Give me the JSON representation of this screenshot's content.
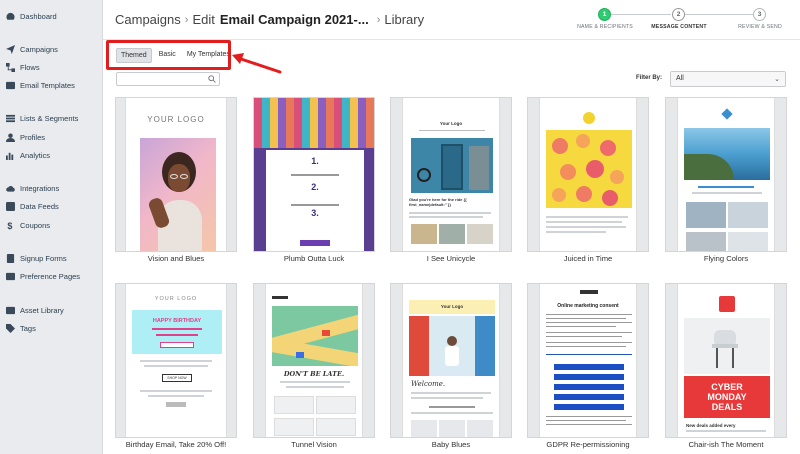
{
  "sidebar": {
    "items": [
      {
        "label": "Dashboard",
        "icon": "dashboard-icon"
      },
      {
        "label": "Campaigns",
        "icon": "send-icon"
      },
      {
        "label": "Flows",
        "icon": "flow-icon"
      },
      {
        "label": "Email Templates",
        "icon": "template-icon"
      },
      {
        "label": "Lists & Segments",
        "icon": "list-icon"
      },
      {
        "label": "Profiles",
        "icon": "user-icon"
      },
      {
        "label": "Analytics",
        "icon": "chart-icon"
      },
      {
        "label": "Integrations",
        "icon": "cloud-icon"
      },
      {
        "label": "Data Feeds",
        "icon": "feed-icon"
      },
      {
        "label": "Coupons",
        "icon": "coupon-icon"
      },
      {
        "label": "Signup Forms",
        "icon": "form-icon"
      },
      {
        "label": "Preference Pages",
        "icon": "page-icon"
      },
      {
        "label": "Asset Library",
        "icon": "image-icon"
      },
      {
        "label": "Tags",
        "icon": "tag-icon"
      }
    ]
  },
  "breadcrumb": {
    "part1": "Campaigns",
    "part2": "Edit",
    "part3": "Email Campaign 2021-...",
    "part4": "Library"
  },
  "steps": [
    {
      "num": "1",
      "label": "NAME & RECIPIENTS",
      "state": "done"
    },
    {
      "num": "2",
      "label": "MESSAGE CONTENT",
      "state": "active"
    },
    {
      "num": "3",
      "label": "REVIEW & SEND",
      "state": "todo"
    }
  ],
  "tabs": [
    {
      "label": "Themed",
      "active": true
    },
    {
      "label": "Basic",
      "active": false
    },
    {
      "label": "My Templates",
      "active": false
    }
  ],
  "search": {
    "placeholder": ""
  },
  "filter": {
    "label": "Filter By:",
    "value": "All"
  },
  "templates": [
    {
      "name": "Vision and Blues",
      "logo": "YOUR LOGO"
    },
    {
      "name": "Plumb Outta Luck"
    },
    {
      "name": "I See Unicycle",
      "logo": "Your Logo",
      "headline": "Glad you're here for the ride {{ first_name|default:'' }}"
    },
    {
      "name": "Juiced in Time"
    },
    {
      "name": "Flying Colors"
    },
    {
      "name": "Birthday Email, Take 20% Off!",
      "logo": "YOUR LOGO",
      "headline": "HAPPY BIRTHDAY",
      "button": "SHOP NOW"
    },
    {
      "name": "Tunnel Vision",
      "headline": "DON'T BE LATE."
    },
    {
      "name": "Baby Blues",
      "logo": "Your Logo",
      "headline": "Welcome."
    },
    {
      "name": "GDPR Re-permissioning",
      "headline": "Online marketing consent"
    },
    {
      "name": "Chair-ish The Moment",
      "headline": "CYBER MONDAY DEALS",
      "footer": "New deals added every"
    }
  ],
  "colors": {
    "accent_green": "#2ecc71",
    "highlight_red": "#e21d1d",
    "sidebar_bg": "#e9ebee"
  }
}
